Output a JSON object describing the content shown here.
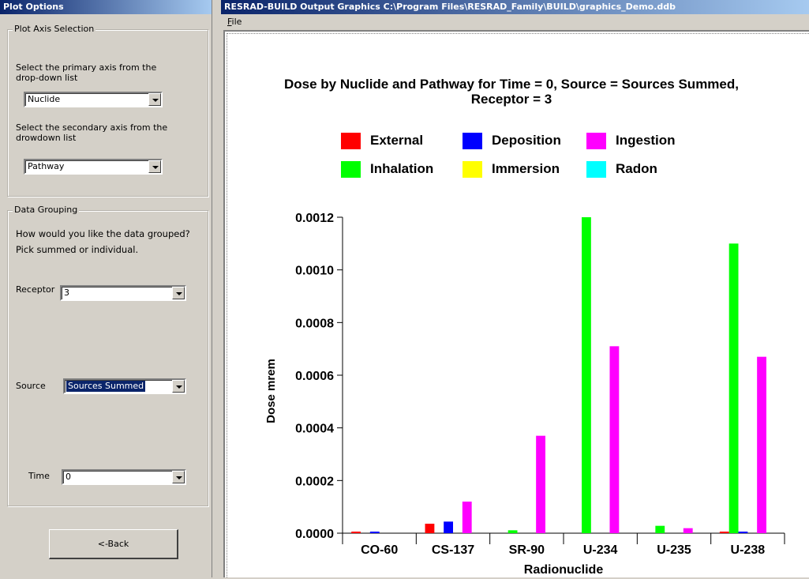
{
  "left_panel": {
    "title": "Plot Options",
    "axis_group": {
      "legend": "Plot Axis Selection",
      "primary_label_1": "Select the primary axis from the",
      "primary_label_2": "drop-down list",
      "primary_value": "Nuclide",
      "secondary_label_1": "Select the secondary axis from the",
      "secondary_label_2": "drowdown list",
      "secondary_value": "Pathway"
    },
    "grouping": {
      "legend": "Data Grouping",
      "question_1": "How would you like the data grouped?",
      "question_2": "Pick summed or individual.",
      "receptor_label": "Receptor",
      "receptor_value": "3",
      "source_label": "Source",
      "source_value": "Sources Summed",
      "time_label": "Time",
      "time_value": "0"
    },
    "back_label": "<-Back"
  },
  "right_panel": {
    "title": "RESRAD-BUILD Output Graphics C:\\Program Files\\RESRAD_Family\\BUILD\\graphics_Demo.ddb",
    "menu_file": "File"
  },
  "chart_data": {
    "type": "bar",
    "title_line1": "Dose by Nuclide and Pathway for Time = 0, Source = Sources Summed,",
    "title_line2": "Receptor = 3",
    "xlabel": "Radionuclide",
    "ylabel": "Dose mrem",
    "ylim": [
      0,
      0.0012
    ],
    "yticks": [
      "0.0000",
      "0.0002",
      "0.0004",
      "0.0006",
      "0.0008",
      "0.0010",
      "0.0012"
    ],
    "legend_position": "top",
    "categories": [
      "CO-60",
      "CS-137",
      "SR-90",
      "U-234",
      "U-235",
      "U-238"
    ],
    "series": [
      {
        "name": "External",
        "color": "#ff0000",
        "values": [
          6e-06,
          3.6e-05,
          0,
          0,
          0,
          3e-06
        ]
      },
      {
        "name": "Inhalation",
        "color": "#00ff00",
        "values": [
          0,
          0,
          1.1e-05,
          0.0012,
          2.8e-05,
          0.0011
        ]
      },
      {
        "name": "Deposition",
        "color": "#0000ff",
        "values": [
          3e-06,
          4.4e-05,
          0,
          0,
          0,
          3e-06
        ]
      },
      {
        "name": "Immersion",
        "color": "#ffff00",
        "values": [
          0,
          0,
          0,
          0,
          0,
          0
        ]
      },
      {
        "name": "Ingestion",
        "color": "#ff00ff",
        "values": [
          0,
          0.00012,
          0.00037,
          0.00071,
          1.9e-05,
          0.00067
        ]
      },
      {
        "name": "Radon",
        "color": "#00ffff",
        "values": [
          0,
          0,
          0,
          0,
          0,
          0
        ]
      }
    ]
  }
}
